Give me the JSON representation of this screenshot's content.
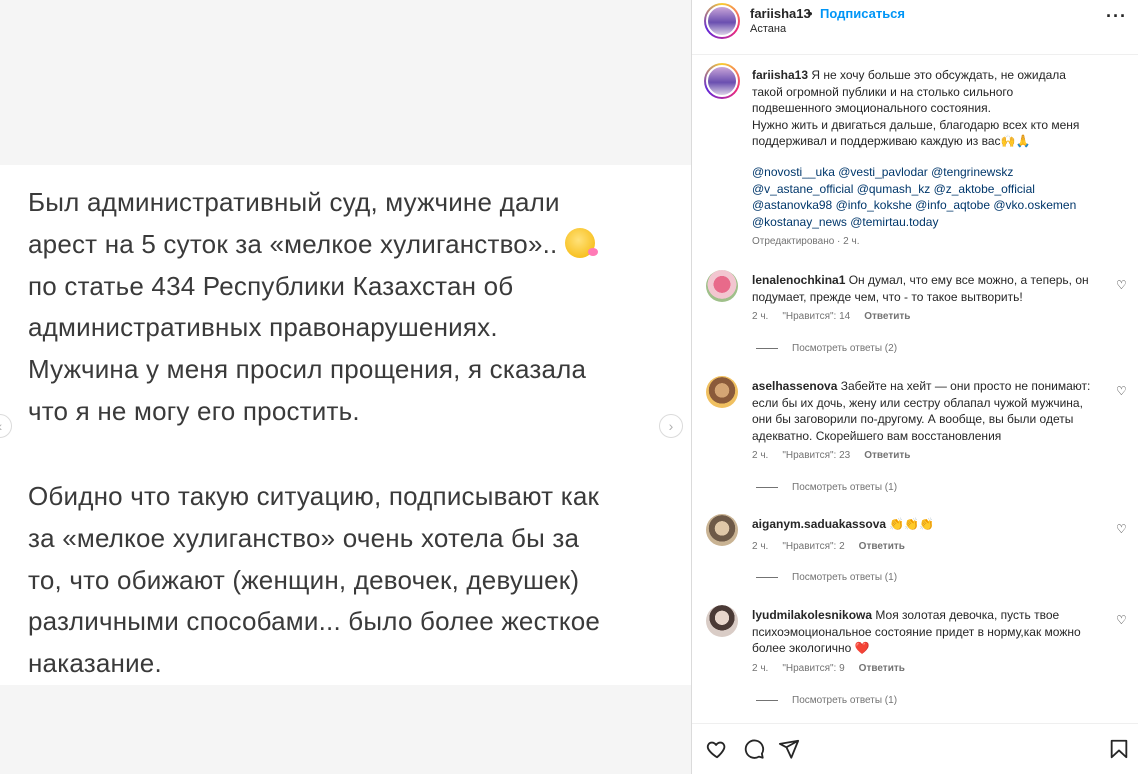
{
  "media": {
    "paragraph1": "Был административный суд, мужчине дали\nарест на 5 суток за «мелкое хулиганство».. ",
    "paragraph1b": "по статье 434 Республики Казахстан об\nадминистративных правонарушениях.\nМужчина у меня просил прощения, я сказала\nчто я не могу его простить.",
    "paragraph2": "Обидно что такую ситуацию, подписывают как\nза «мелкое хулиганство» очень хотела бы за\nто, что обижают (женщин, девочек, девушек)\nразличными способами... было более жесткое\nнаказание."
  },
  "header": {
    "username": "fariisha13",
    "dot": "•",
    "follow_label": "Подписаться",
    "location": "Астана",
    "more_label": "..."
  },
  "caption": {
    "username": "fariisha13",
    "text": "Я не хочу больше это обсуждать, не ожидала такой огромной публики и на столько сильного подвешенного эмоционального состояния.",
    "text2": "Нужно жить и двигаться дальше, благодарю всех кто меня поддерживал и поддерживаю каждую из вас🙌🙏",
    "tags": "@novosti__uka @vesti_pavlodar @tengrinewskz @v_astane_official @qumash_kz @z_aktobe_official @astanovka98 @info_kokshe @info_aqtobe @vko.oskemen @kostanay_news @temirtau.today",
    "edited": "Отредактировано · 2 ч."
  },
  "comments": [
    {
      "username": "lenalenochkina1",
      "text": "Он думал, что ему все можно, а теперь, он подумает, прежде чем, что - то такое вытворить!",
      "time": "2 ч.",
      "likes": "\"Нравится\": 14",
      "reply_label": "Ответить",
      "replies": "Посмотреть ответы (2)",
      "avatar_color": "#e8a6b8"
    },
    {
      "username": "aselhassenova",
      "text": "Забейте на хейт — они просто не понимают: если бы их дочь, жену или сестру облапал чужой мужчина, они бы заговорили по-другому. А вообще, вы были одеты адекватно. Скорейшего вам восстановления",
      "time": "2 ч.",
      "likes": "\"Нравится\": 23",
      "reply_label": "Ответить",
      "replies": "Посмотреть ответы (1)",
      "avatar_color": "#c79a6a"
    },
    {
      "username": "aiganym.saduakassova",
      "text": "👏👏👏",
      "time": "2 ч.",
      "likes": "\"Нравится\": 2",
      "reply_label": "Ответить",
      "replies": "Посмотреть ответы (1)",
      "avatar_color": "#b8a082"
    },
    {
      "username": "lyudmilakolesnikowa",
      "text": "Моя золотая девочка, пусть твое психоэмоциональное состояние придет в норму,как можно более экологично ❤️",
      "time": "2 ч.",
      "likes": "\"Нравится\": 9",
      "reply_label": "Ответить",
      "replies": "Посмотреть ответы (1)",
      "avatar_color": "#a58f8a"
    }
  ],
  "icons": {
    "like": "heart-icon",
    "comment": "comment-icon",
    "share": "share-icon",
    "save": "bookmark-icon"
  }
}
